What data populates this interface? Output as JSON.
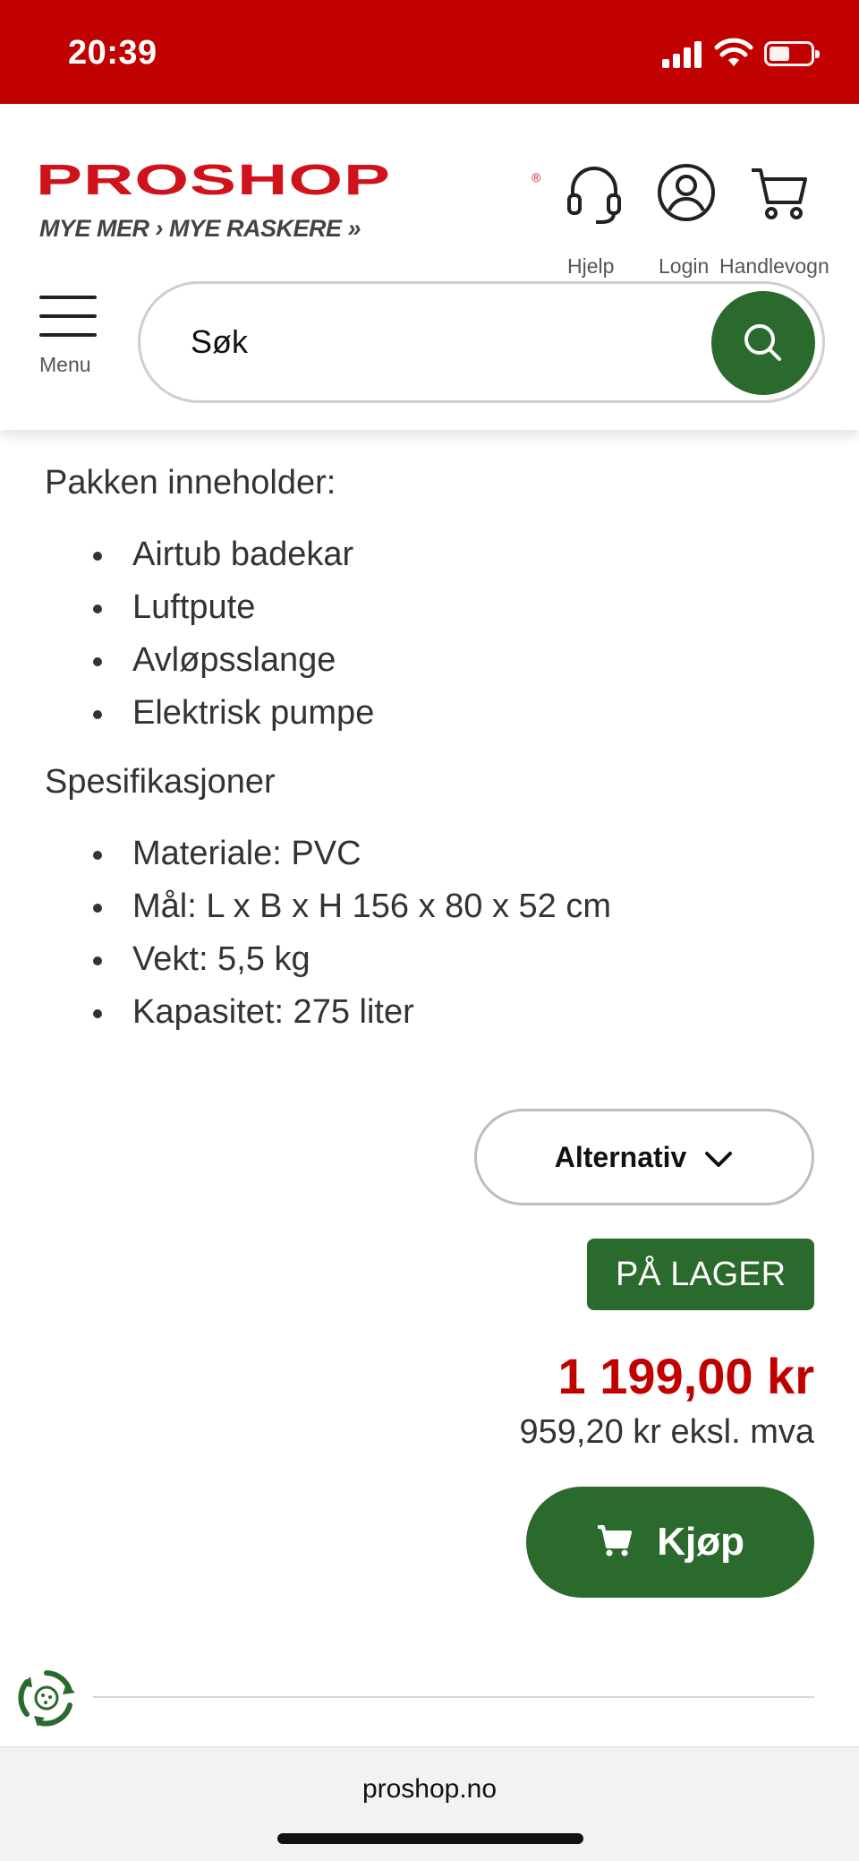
{
  "status_bar": {
    "time": "20:39"
  },
  "header": {
    "logo": "PROSHOP",
    "tagline": "MYE MER › MYE RASKERE »",
    "help_label": "Hjelp",
    "login_label": "Login",
    "cart_label": "Handlevogn",
    "menu_label": "Menu",
    "search_placeholder": "Søk"
  },
  "content": {
    "partial_top_text": "",
    "package_title": "Pakken inneholder:",
    "package_items": [
      "Airtub badekar",
      "Luftpute",
      "Avløpsslange",
      "Elektrisk pumpe"
    ],
    "specs_title": "Spesifikasjoner",
    "spec_items": [
      "Materiale: PVC",
      "Mål: L x B x H 156 x 80 x 52 cm",
      "Vekt: 5,5 kg",
      "Kapasitet: 275 liter"
    ],
    "alternative_label": "Alternativ",
    "stock_label": "PÅ LAGER",
    "price": "1 199,00 kr",
    "price_ex_vat": "959,20 kr eksl. mva",
    "buy_label": "Kjøp"
  },
  "browser": {
    "url": "proshop.no"
  },
  "colors": {
    "brand_red": "#c10000",
    "brand_green": "#2a6a2c"
  }
}
